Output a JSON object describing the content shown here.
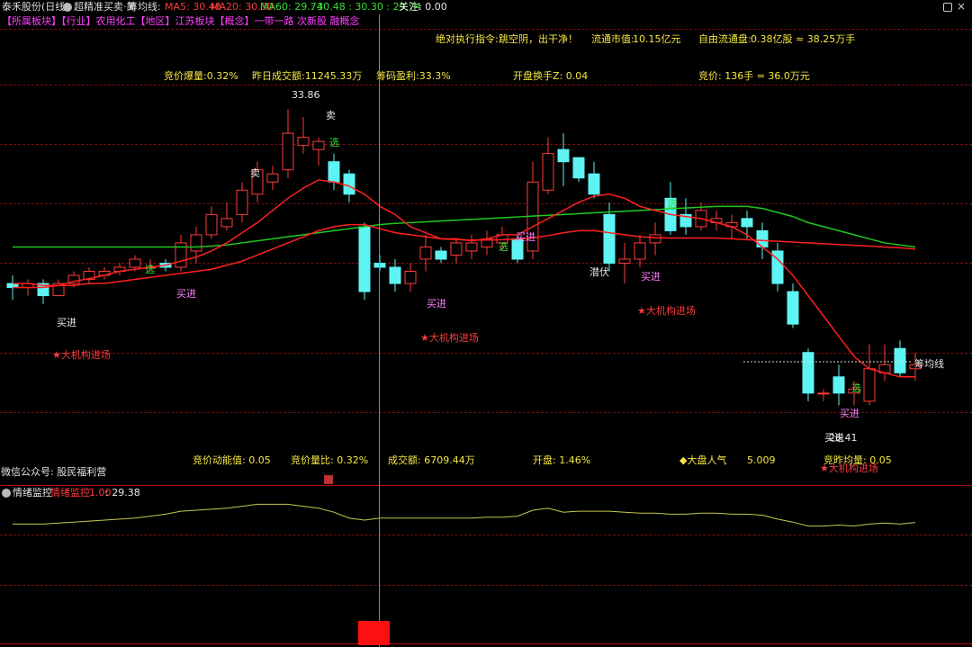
{
  "title_bar": {
    "stock": "泰禾股份(日线)",
    "indicator": "超精准买卖·简",
    "chip_line_label": "筹均线:",
    "ma5_label": "MA5: 30.48",
    "ma20_label": "MA20: 30.30",
    "ma60_label": "MA60: 29.74",
    "ma_tail": ": 30.48 : 30.30 : 29.74",
    "focus_label": "关注: 0.00"
  },
  "tags_line": "【所属板块】【行业】农用化工【地区】江苏板块【概念】一带一路 次新股 融概念",
  "info_top": {
    "order_label": "绝对执行指令:",
    "order_value": "跳空阴，出干净！",
    "float_value_label": "流通市值:",
    "float_value": "10.15亿元",
    "free_float_label": "自由流通盘:",
    "free_float_value": "0.38亿股 ≈ 38.25万手"
  },
  "info_row2": {
    "bid_burst": "竞价爆量:0.32%",
    "yesterday_turnover": "昨日成交额:11245.33万",
    "chip_profit": "筹码盈利:33.3%",
    "open_turnover": "开盘换手Z:  0.04",
    "bid_price": "竞价:  136手 = 36.0万元"
  },
  "chart_labels": {
    "high_price": "33.86",
    "low_price": "26.41",
    "sell": "卖",
    "buy_in": "买进",
    "institution": "★大机构进场",
    "select": "选",
    "hidden": "潜伏",
    "chip_avg_line": "筹均线"
  },
  "info_bottom": {
    "wechat": "微信公众号: 股民福利营",
    "bid_momentum": "竞价动能值:  0.05",
    "bid_volume_ratio": "竞价量比:  0.32%",
    "turnover": "成交额:  6709.44万",
    "open": "开盘:  1.46%",
    "market_popularity_label": "◆大盘人气",
    "market_popularity": "5.009",
    "bid_yesterday_avg": "竞昨均量:  0.05"
  },
  "lower_panel": {
    "title": "情绪监控",
    "indicator": "情绪监控",
    "value1": "1.00",
    "value2": ": 29.38"
  },
  "colors": {
    "up": "#ff3b3b",
    "down": "#5ff4f4",
    "ma_short": "#ff2020",
    "ma_long": "#20c820",
    "mood": "#c8c850"
  },
  "chart_data": {
    "type": "candlestick",
    "ylim": [
      25.5,
      34.5
    ],
    "candles": [
      {
        "o": 29.6,
        "h": 29.8,
        "l": 29.2,
        "c": 29.5
      },
      {
        "o": 29.5,
        "h": 29.7,
        "l": 29.3,
        "c": 29.6
      },
      {
        "o": 29.6,
        "h": 29.7,
        "l": 29.1,
        "c": 29.3
      },
      {
        "o": 29.3,
        "h": 29.7,
        "l": 29.3,
        "c": 29.6
      },
      {
        "o": 29.6,
        "h": 29.9,
        "l": 29.5,
        "c": 29.8
      },
      {
        "o": 29.7,
        "h": 30.0,
        "l": 29.6,
        "c": 29.9
      },
      {
        "o": 29.8,
        "h": 30.0,
        "l": 29.7,
        "c": 29.9
      },
      {
        "o": 29.9,
        "h": 30.1,
        "l": 29.8,
        "c": 30.0
      },
      {
        "o": 30.0,
        "h": 30.3,
        "l": 29.9,
        "c": 30.2
      },
      {
        "o": 30.0,
        "h": 30.2,
        "l": 29.9,
        "c": 30.0
      },
      {
        "o": 30.1,
        "h": 30.2,
        "l": 29.9,
        "c": 30.0
      },
      {
        "o": 30.0,
        "h": 30.8,
        "l": 29.9,
        "c": 30.6
      },
      {
        "o": 30.4,
        "h": 31.0,
        "l": 30.1,
        "c": 30.8
      },
      {
        "o": 30.8,
        "h": 31.5,
        "l": 30.7,
        "c": 31.3
      },
      {
        "o": 31.0,
        "h": 31.6,
        "l": 30.9,
        "c": 31.2
      },
      {
        "o": 31.3,
        "h": 32.1,
        "l": 31.1,
        "c": 31.9
      },
      {
        "o": 31.8,
        "h": 32.6,
        "l": 31.6,
        "c": 32.4
      },
      {
        "o": 32.1,
        "h": 32.5,
        "l": 31.9,
        "c": 32.3
      },
      {
        "o": 32.4,
        "h": 33.9,
        "l": 32.2,
        "c": 33.3
      },
      {
        "o": 33.0,
        "h": 33.7,
        "l": 32.8,
        "c": 33.2
      },
      {
        "o": 32.9,
        "h": 33.2,
        "l": 32.5,
        "c": 33.1
      },
      {
        "o": 32.6,
        "h": 32.8,
        "l": 31.9,
        "c": 32.1
      },
      {
        "o": 32.3,
        "h": 32.4,
        "l": 31.6,
        "c": 31.8
      },
      {
        "o": 31.0,
        "h": 31.1,
        "l": 29.2,
        "c": 29.4
      },
      {
        "o": 30.1,
        "h": 30.3,
        "l": 29.9,
        "c": 30.0
      },
      {
        "o": 30.0,
        "h": 30.2,
        "l": 29.4,
        "c": 29.6
      },
      {
        "o": 29.6,
        "h": 30.1,
        "l": 29.4,
        "c": 29.9
      },
      {
        "o": 30.2,
        "h": 30.8,
        "l": 29.9,
        "c": 30.5
      },
      {
        "o": 30.4,
        "h": 30.5,
        "l": 30.1,
        "c": 30.2
      },
      {
        "o": 30.3,
        "h": 30.7,
        "l": 30.1,
        "c": 30.6
      },
      {
        "o": 30.4,
        "h": 30.8,
        "l": 30.2,
        "c": 30.6
      },
      {
        "o": 30.5,
        "h": 30.9,
        "l": 30.3,
        "c": 30.7
      },
      {
        "o": 30.6,
        "h": 31.0,
        "l": 30.4,
        "c": 30.8
      },
      {
        "o": 30.7,
        "h": 30.8,
        "l": 30.1,
        "c": 30.2
      },
      {
        "o": 30.4,
        "h": 32.6,
        "l": 30.2,
        "c": 32.1
      },
      {
        "o": 31.9,
        "h": 33.2,
        "l": 31.8,
        "c": 32.8
      },
      {
        "o": 32.9,
        "h": 33.3,
        "l": 32.0,
        "c": 32.6
      },
      {
        "o": 32.7,
        "h": 32.7,
        "l": 32.1,
        "c": 32.2
      },
      {
        "o": 32.3,
        "h": 32.6,
        "l": 31.7,
        "c": 31.8
      },
      {
        "o": 31.3,
        "h": 31.6,
        "l": 29.9,
        "c": 30.1
      },
      {
        "o": 30.1,
        "h": 30.6,
        "l": 29.6,
        "c": 30.2
      },
      {
        "o": 30.2,
        "h": 30.8,
        "l": 30.0,
        "c": 30.6
      },
      {
        "o": 30.6,
        "h": 31.1,
        "l": 30.3,
        "c": 30.8
      },
      {
        "o": 31.7,
        "h": 32.1,
        "l": 30.8,
        "c": 30.9
      },
      {
        "o": 31.3,
        "h": 31.7,
        "l": 30.8,
        "c": 31.0
      },
      {
        "o": 31.0,
        "h": 31.6,
        "l": 30.9,
        "c": 31.4
      },
      {
        "o": 31.1,
        "h": 31.4,
        "l": 30.9,
        "c": 31.2
      },
      {
        "o": 31.0,
        "h": 31.3,
        "l": 30.7,
        "c": 31.1
      },
      {
        "o": 31.2,
        "h": 31.4,
        "l": 30.7,
        "c": 31.0
      },
      {
        "o": 30.9,
        "h": 31.1,
        "l": 30.2,
        "c": 30.5
      },
      {
        "o": 30.4,
        "h": 30.6,
        "l": 29.4,
        "c": 29.6
      },
      {
        "o": 29.4,
        "h": 29.6,
        "l": 28.5,
        "c": 28.6
      },
      {
        "o": 27.9,
        "h": 28.0,
        "l": 26.7,
        "c": 26.9
      },
      {
        "o": 26.9,
        "h": 27.0,
        "l": 26.7,
        "c": 26.9
      },
      {
        "o": 27.3,
        "h": 27.6,
        "l": 26.6,
        "c": 26.9
      },
      {
        "o": 26.9,
        "h": 27.2,
        "l": 26.6,
        "c": 27.0
      },
      {
        "o": 26.7,
        "h": 28.1,
        "l": 26.6,
        "c": 27.5
      },
      {
        "o": 27.4,
        "h": 28.1,
        "l": 27.2,
        "c": 27.6
      },
      {
        "o": 28.0,
        "h": 28.2,
        "l": 27.3,
        "c": 27.4
      },
      {
        "o": 27.5,
        "h": 27.9,
        "l": 27.2,
        "c": 27.6
      }
    ],
    "ma_short": [
      29.5,
      29.5,
      29.5,
      29.55,
      29.65,
      29.72,
      29.8,
      29.9,
      29.95,
      30.0,
      30.05,
      30.15,
      30.25,
      30.4,
      30.6,
      30.85,
      31.1,
      31.4,
      31.7,
      31.95,
      32.15,
      32.1,
      32.0,
      31.8,
      31.5,
      31.3,
      31.0,
      30.85,
      30.7,
      30.7,
      30.65,
      30.7,
      30.8,
      30.8,
      31.0,
      31.2,
      31.4,
      31.6,
      31.75,
      31.8,
      31.7,
      31.5,
      31.4,
      31.3,
      31.25,
      31.2,
      31.1,
      31.0,
      30.8,
      30.5,
      30.2,
      29.8,
      29.3,
      28.8,
      28.3,
      27.8,
      27.5,
      27.4,
      27.3,
      27.3
    ],
    "ma_mid": [
      29.6,
      29.6,
      29.55,
      29.55,
      29.55,
      29.6,
      29.6,
      29.65,
      29.7,
      29.75,
      29.8,
      29.85,
      29.9,
      29.95,
      30.05,
      30.15,
      30.3,
      30.45,
      30.6,
      30.75,
      30.9,
      31.0,
      31.05,
      31.05,
      30.95,
      30.85,
      30.8,
      30.75,
      30.7,
      30.68,
      30.67,
      30.67,
      30.68,
      30.7,
      30.72,
      30.78,
      30.85,
      30.9,
      30.9,
      30.85,
      30.8,
      30.75,
      30.73,
      30.72,
      30.72,
      30.72,
      30.72,
      30.7,
      30.68,
      30.66,
      30.64,
      30.62,
      30.6,
      30.58,
      30.56,
      30.54,
      30.52,
      30.5,
      30.48,
      30.45
    ],
    "ma_long": [
      30.5,
      30.5,
      30.5,
      30.5,
      30.5,
      30.5,
      30.5,
      30.5,
      30.5,
      30.5,
      30.5,
      30.5,
      30.5,
      30.52,
      30.55,
      30.6,
      30.65,
      30.7,
      30.75,
      30.8,
      30.85,
      30.9,
      30.95,
      31.0,
      31.05,
      31.08,
      31.1,
      31.12,
      31.14,
      31.16,
      31.18,
      31.2,
      31.22,
      31.24,
      31.26,
      31.28,
      31.3,
      31.32,
      31.34,
      31.36,
      31.38,
      31.4,
      31.42,
      31.44,
      31.46,
      31.48,
      31.5,
      31.5,
      31.5,
      31.45,
      31.35,
      31.25,
      31.1,
      31.0,
      30.9,
      30.8,
      30.7,
      30.6,
      30.55,
      30.5
    ],
    "mood": [
      29.3,
      29.3,
      29.3,
      29.35,
      29.4,
      29.45,
      29.5,
      29.55,
      29.6,
      29.7,
      29.8,
      29.95,
      30.0,
      30.05,
      30.1,
      30.2,
      30.3,
      30.3,
      30.3,
      30.2,
      30.1,
      29.9,
      29.6,
      29.5,
      29.6,
      29.6,
      29.6,
      29.6,
      29.6,
      29.6,
      29.6,
      29.65,
      29.65,
      29.7,
      30.0,
      30.1,
      29.9,
      29.95,
      29.95,
      29.95,
      29.9,
      29.85,
      29.85,
      29.8,
      29.8,
      29.85,
      29.85,
      29.8,
      29.8,
      29.75,
      29.55,
      29.4,
      29.2,
      29.2,
      29.25,
      29.2,
      29.3,
      29.35,
      29.3,
      29.38
    ]
  }
}
